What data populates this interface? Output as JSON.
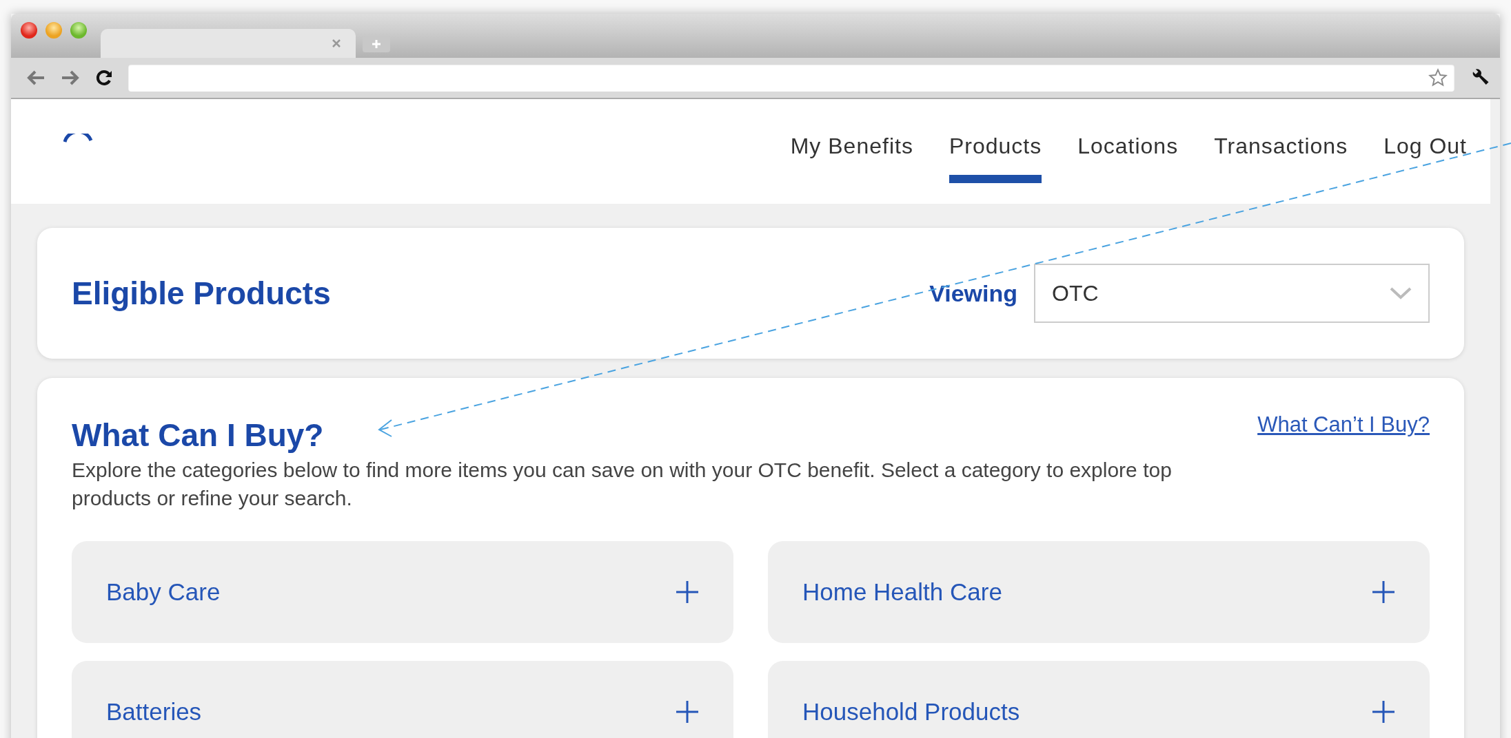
{
  "nav": [
    {
      "label": "My Benefits",
      "selected": false
    },
    {
      "label": "Products",
      "selected": true
    },
    {
      "label": "Locations",
      "selected": false
    },
    {
      "label": "Transactions",
      "selected": false
    },
    {
      "label": "Log Out",
      "selected": false
    }
  ],
  "header": {
    "title": "Eligible Products",
    "viewing_label": "Viewing",
    "viewing_value": "OTC"
  },
  "section": {
    "title": "What Can I Buy?",
    "link": "What Can’t I Buy?",
    "description": "Explore the categories below to find more items you can save on with your OTC benefit. Select a category to explore top products or refine your search."
  },
  "categories": [
    {
      "label": "Baby Care"
    },
    {
      "label": "Home Health Care"
    },
    {
      "label": "Batteries"
    },
    {
      "label": "Household Products"
    }
  ]
}
